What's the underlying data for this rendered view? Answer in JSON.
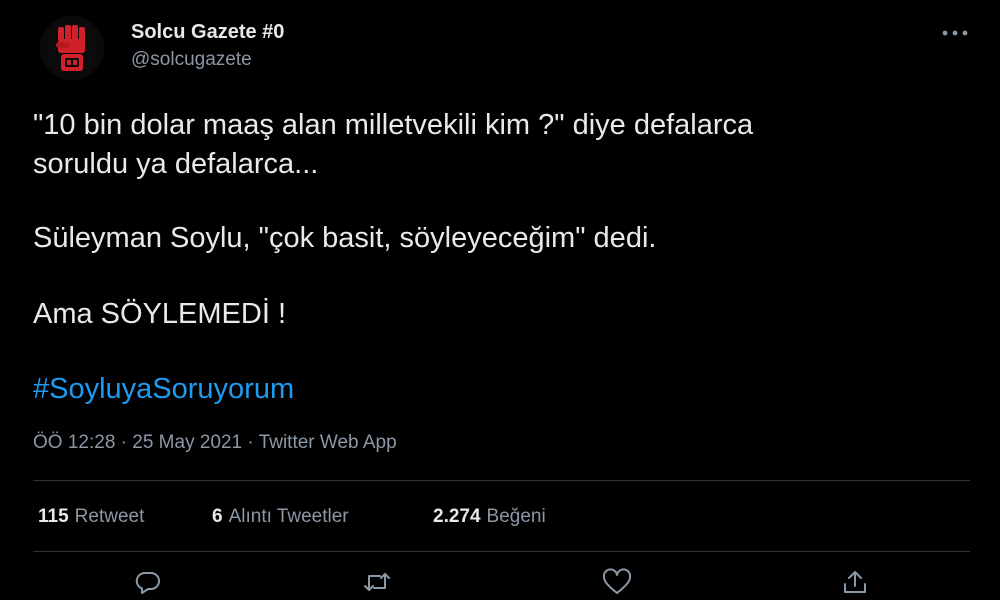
{
  "tweet": {
    "author": {
      "display_name": "Solcu Gazete #0",
      "handle": "@solcugazete",
      "avatar_icon": "raised-fist-logo",
      "avatar_color": "#d1202a"
    },
    "more_icon": "ellipsis-icon",
    "text_lines": [
      "\"10 bin dolar maaş alan milletvekili kim ?\" diye defalarca",
      "soruldu ya defalarca...",
      "Süleyman Soylu, \"çok basit, söyleyeceğim\" dedi.",
      "Ama SÖYLEMEDİ !"
    ],
    "hashtag": "#SoyluyaSoruyorum",
    "meta": "ÖÖ 12:28 · 25 May 2021 · Twitter Web App",
    "stats": {
      "retweets": {
        "count": "115",
        "label": "Retweet"
      },
      "quotes": {
        "count": "6",
        "label": "Alıntı Tweetler"
      },
      "likes": {
        "count": "2.274",
        "label": "Beğeni"
      }
    },
    "actions": [
      "reply-icon",
      "retweet-icon",
      "like-icon",
      "share-icon"
    ]
  },
  "colors": {
    "background": "#000000",
    "text": "#e7e9ea",
    "secondary": "#8b98a5",
    "link": "#1d9bf0",
    "divider": "#2f3336"
  }
}
